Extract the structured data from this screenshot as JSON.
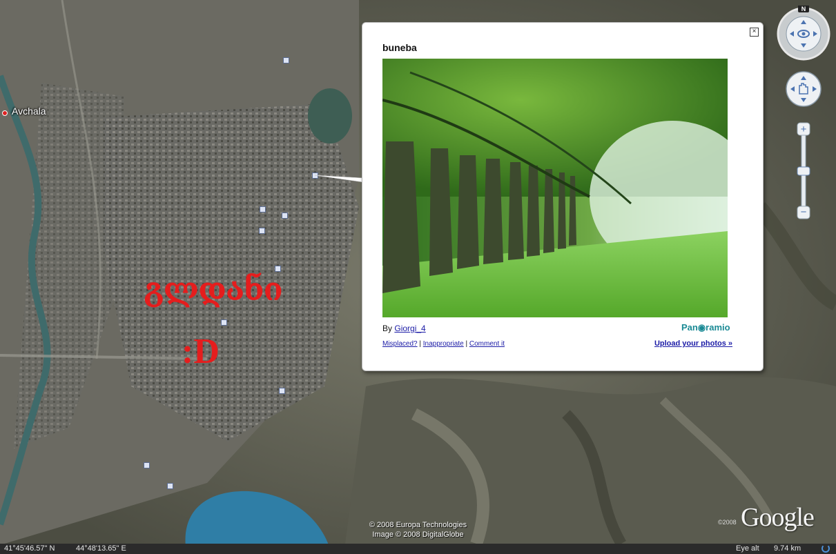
{
  "map": {
    "place_label": "Avchala",
    "overlay_text_georgian": "გლდანი",
    "overlay_text_smiley": ":D",
    "copyright_line1": "© 2008 Europa Technologies",
    "copyright_line2": "Image © 2008 DigitalGlobe",
    "logo_text": "Google",
    "logo_year": "©2008"
  },
  "balloon": {
    "close_glyph": "×",
    "title": "buneba",
    "by_prefix": "By",
    "author": "Giorgi_4",
    "brand": "Pan◉ramio",
    "link_misplaced": "Misplaced?",
    "link_inappropriate": "Inappropriate",
    "link_comment": "Comment it",
    "link_separator": "|",
    "upload": "Upload your photos »"
  },
  "status": {
    "latitude": "41°45'46.57\" N",
    "longitude": "44°48'13.65\" E",
    "eye_alt_label": "Eye alt",
    "eye_alt_value": "9.74 km"
  },
  "navigation": {
    "north_label": "N",
    "zoom_in": "+",
    "zoom_out": "−",
    "zoom_level": 0.5
  },
  "icons": {
    "close": "close-icon",
    "look": "look-joystick-icon",
    "move": "move-hand-icon",
    "streaming": "streaming-progress-icon"
  },
  "colors": {
    "overlay_text": "#e51d1d",
    "link": "#1a1aa6",
    "brand": "#1a8a95",
    "status_bar": "#2b2b2b"
  }
}
